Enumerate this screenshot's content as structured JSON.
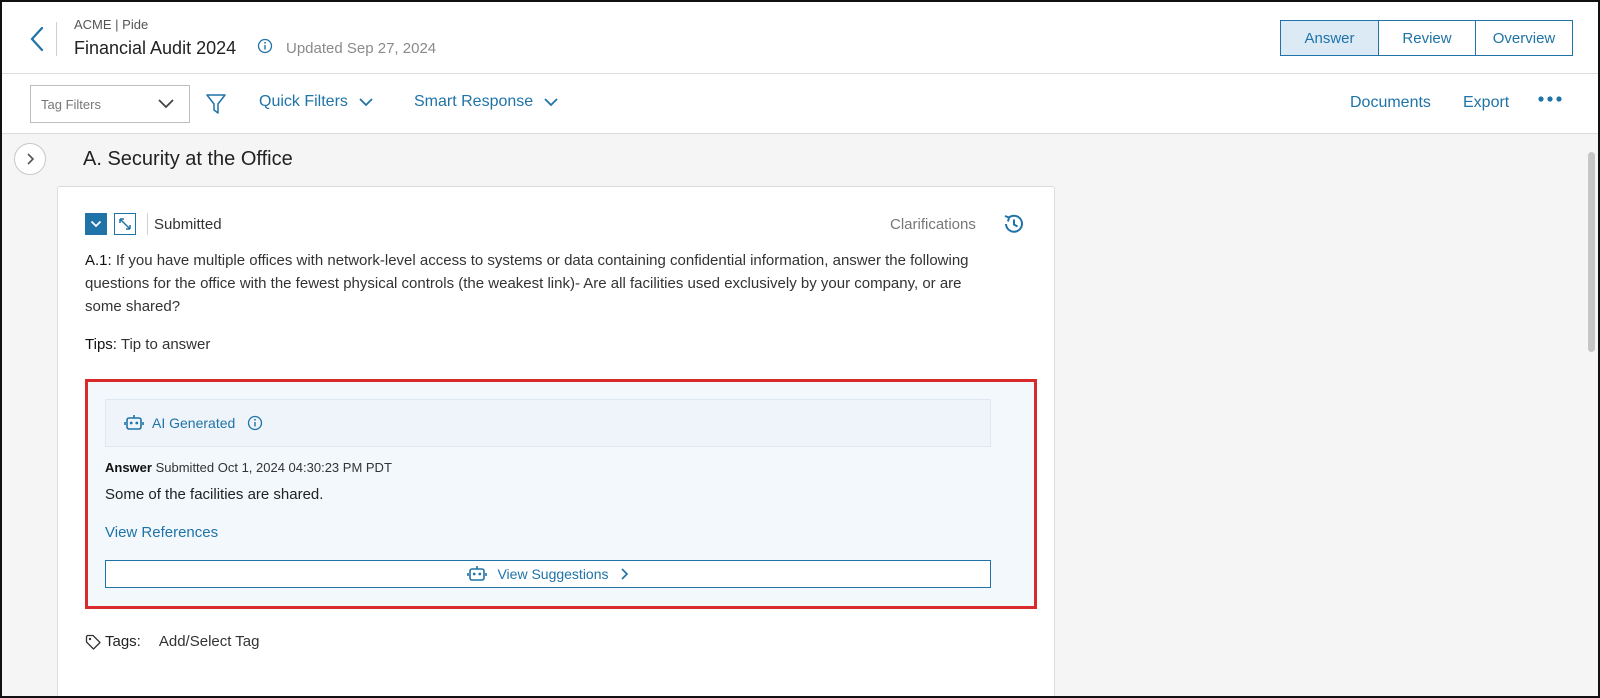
{
  "header": {
    "breadcrumb": "ACME | Pide",
    "title": "Financial Audit 2024",
    "updated": "Updated Sep 27, 2024",
    "tabs": [
      {
        "label": "Answer",
        "active": true
      },
      {
        "label": "Review",
        "active": false
      },
      {
        "label": "Overview",
        "active": false
      }
    ]
  },
  "toolbar": {
    "tag_filters_placeholder": "Tag Filters",
    "quick_filters": "Quick Filters",
    "smart_response": "Smart Response",
    "documents": "Documents",
    "export": "Export"
  },
  "section": {
    "title": "A. Security at the Office"
  },
  "question": {
    "status": "Submitted",
    "clarifications": "Clarifications",
    "id": "A.1:",
    "text": "If you have multiple offices with network-level access to systems or data containing confidential information, answer the following questions for the office with the fewest physical controls (the weakest link)- Are all facilities used exclusively by your company, or are some shared?",
    "tips_label": "Tips:",
    "tips_text": "Tip to answer"
  },
  "answer": {
    "ai_label": "AI Generated",
    "meta_label": "Answer",
    "meta_text": "Submitted Oct 1, 2024 04:30:23 PM PDT",
    "text": "Some of the facilities are shared.",
    "view_references": "View References",
    "view_suggestions": "View Suggestions"
  },
  "tags": {
    "label": "Tags:",
    "add": "Add/Select Tag"
  },
  "colors": {
    "accent": "#1f73a7",
    "highlight": "#d92b2b"
  }
}
